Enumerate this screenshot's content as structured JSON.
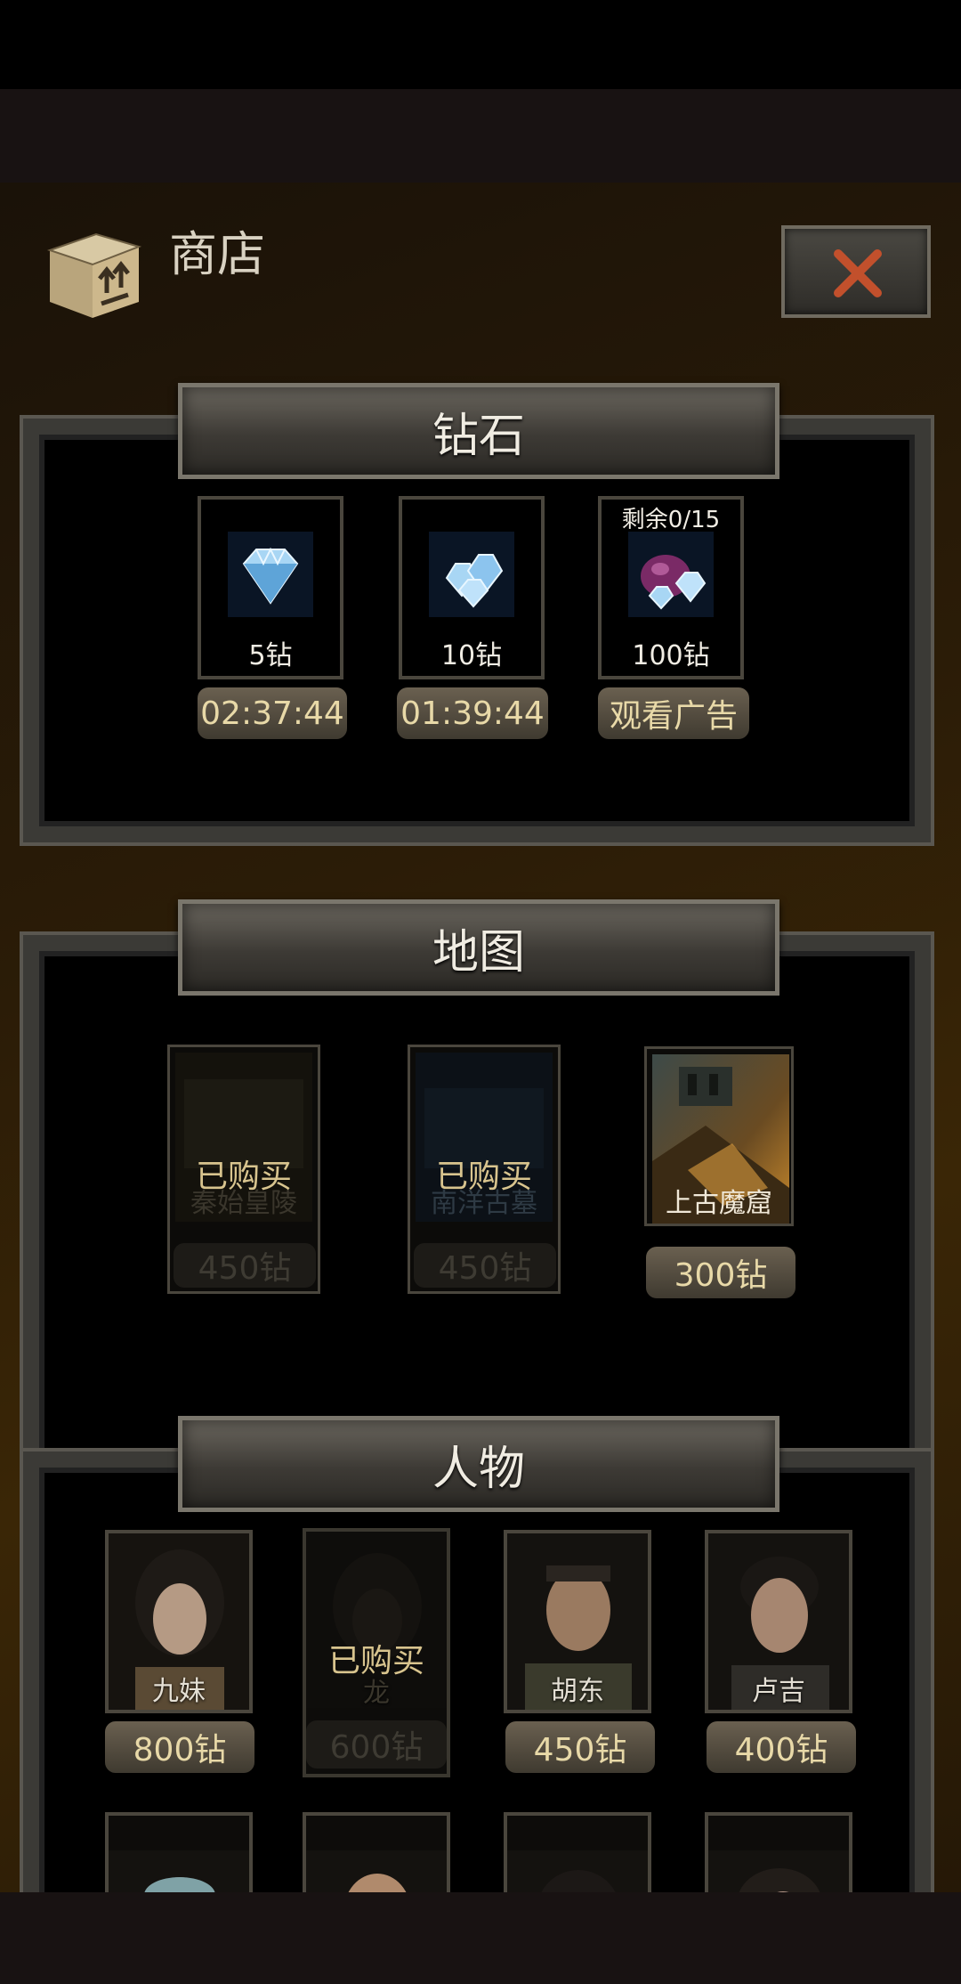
{
  "header": {
    "title": "商店"
  },
  "sections": {
    "diamonds": {
      "title": "钻石",
      "items": [
        {
          "amount": "5钻",
          "timer": "02:37:44"
        },
        {
          "amount": "10钻",
          "timer": "01:39:44"
        },
        {
          "amount": "100钻",
          "remaining": "剩余0/15",
          "action": "观看广告"
        }
      ]
    },
    "maps": {
      "title": "地图",
      "items": [
        {
          "name": "秦始皇陵",
          "status": "已购买",
          "price": "450钻"
        },
        {
          "name": "南洋古墓",
          "status": "已购买",
          "price": "450钻"
        },
        {
          "name": "上古魔窟",
          "price": "300钻"
        }
      ]
    },
    "characters": {
      "title": "人物",
      "items": [
        {
          "name": "九妹",
          "price": "800钻"
        },
        {
          "name": "龙",
          "status": "已购买",
          "price": "600钻"
        },
        {
          "name": "胡东",
          "price": "450钻"
        },
        {
          "name": "卢吉",
          "price": "400钻"
        }
      ]
    }
  },
  "colors": {
    "accent": "#e8d9a8",
    "close": "#c2502c",
    "frame": "#3b3a36"
  }
}
